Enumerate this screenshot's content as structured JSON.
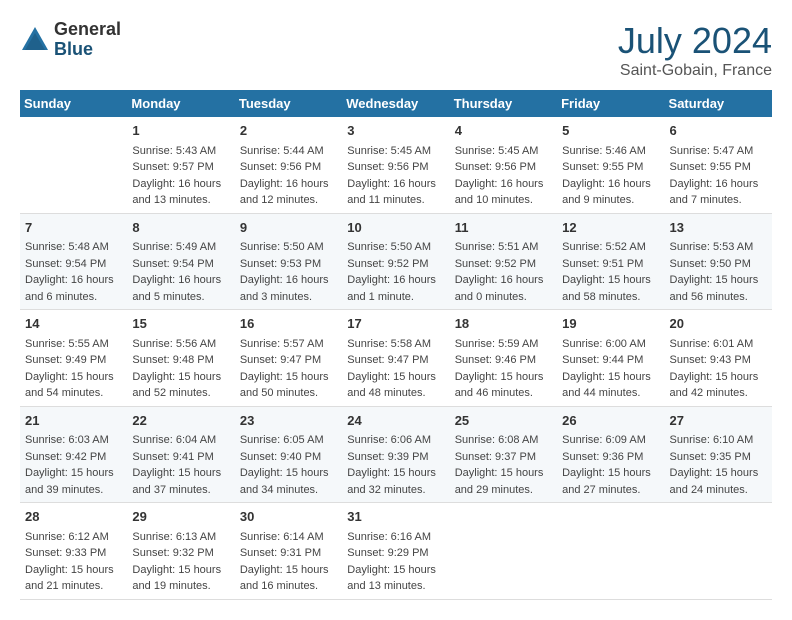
{
  "header": {
    "logo_general": "General",
    "logo_blue": "Blue",
    "month_year": "July 2024",
    "location": "Saint-Gobain, France"
  },
  "weekdays": [
    "Sunday",
    "Monday",
    "Tuesday",
    "Wednesday",
    "Thursday",
    "Friday",
    "Saturday"
  ],
  "weeks": [
    [
      {
        "day": "",
        "sunrise": "",
        "sunset": "",
        "daylight": ""
      },
      {
        "day": "1",
        "sunrise": "Sunrise: 5:43 AM",
        "sunset": "Sunset: 9:57 PM",
        "daylight": "Daylight: 16 hours and 13 minutes."
      },
      {
        "day": "2",
        "sunrise": "Sunrise: 5:44 AM",
        "sunset": "Sunset: 9:56 PM",
        "daylight": "Daylight: 16 hours and 12 minutes."
      },
      {
        "day": "3",
        "sunrise": "Sunrise: 5:45 AM",
        "sunset": "Sunset: 9:56 PM",
        "daylight": "Daylight: 16 hours and 11 minutes."
      },
      {
        "day": "4",
        "sunrise": "Sunrise: 5:45 AM",
        "sunset": "Sunset: 9:56 PM",
        "daylight": "Daylight: 16 hours and 10 minutes."
      },
      {
        "day": "5",
        "sunrise": "Sunrise: 5:46 AM",
        "sunset": "Sunset: 9:55 PM",
        "daylight": "Daylight: 16 hours and 9 minutes."
      },
      {
        "day": "6",
        "sunrise": "Sunrise: 5:47 AM",
        "sunset": "Sunset: 9:55 PM",
        "daylight": "Daylight: 16 hours and 7 minutes."
      }
    ],
    [
      {
        "day": "7",
        "sunrise": "Sunrise: 5:48 AM",
        "sunset": "Sunset: 9:54 PM",
        "daylight": "Daylight: 16 hours and 6 minutes."
      },
      {
        "day": "8",
        "sunrise": "Sunrise: 5:49 AM",
        "sunset": "Sunset: 9:54 PM",
        "daylight": "Daylight: 16 hours and 5 minutes."
      },
      {
        "day": "9",
        "sunrise": "Sunrise: 5:50 AM",
        "sunset": "Sunset: 9:53 PM",
        "daylight": "Daylight: 16 hours and 3 minutes."
      },
      {
        "day": "10",
        "sunrise": "Sunrise: 5:50 AM",
        "sunset": "Sunset: 9:52 PM",
        "daylight": "Daylight: 16 hours and 1 minute."
      },
      {
        "day": "11",
        "sunrise": "Sunrise: 5:51 AM",
        "sunset": "Sunset: 9:52 PM",
        "daylight": "Daylight: 16 hours and 0 minutes."
      },
      {
        "day": "12",
        "sunrise": "Sunrise: 5:52 AM",
        "sunset": "Sunset: 9:51 PM",
        "daylight": "Daylight: 15 hours and 58 minutes."
      },
      {
        "day": "13",
        "sunrise": "Sunrise: 5:53 AM",
        "sunset": "Sunset: 9:50 PM",
        "daylight": "Daylight: 15 hours and 56 minutes."
      }
    ],
    [
      {
        "day": "14",
        "sunrise": "Sunrise: 5:55 AM",
        "sunset": "Sunset: 9:49 PM",
        "daylight": "Daylight: 15 hours and 54 minutes."
      },
      {
        "day": "15",
        "sunrise": "Sunrise: 5:56 AM",
        "sunset": "Sunset: 9:48 PM",
        "daylight": "Daylight: 15 hours and 52 minutes."
      },
      {
        "day": "16",
        "sunrise": "Sunrise: 5:57 AM",
        "sunset": "Sunset: 9:47 PM",
        "daylight": "Daylight: 15 hours and 50 minutes."
      },
      {
        "day": "17",
        "sunrise": "Sunrise: 5:58 AM",
        "sunset": "Sunset: 9:47 PM",
        "daylight": "Daylight: 15 hours and 48 minutes."
      },
      {
        "day": "18",
        "sunrise": "Sunrise: 5:59 AM",
        "sunset": "Sunset: 9:46 PM",
        "daylight": "Daylight: 15 hours and 46 minutes."
      },
      {
        "day": "19",
        "sunrise": "Sunrise: 6:00 AM",
        "sunset": "Sunset: 9:44 PM",
        "daylight": "Daylight: 15 hours and 44 minutes."
      },
      {
        "day": "20",
        "sunrise": "Sunrise: 6:01 AM",
        "sunset": "Sunset: 9:43 PM",
        "daylight": "Daylight: 15 hours and 42 minutes."
      }
    ],
    [
      {
        "day": "21",
        "sunrise": "Sunrise: 6:03 AM",
        "sunset": "Sunset: 9:42 PM",
        "daylight": "Daylight: 15 hours and 39 minutes."
      },
      {
        "day": "22",
        "sunrise": "Sunrise: 6:04 AM",
        "sunset": "Sunset: 9:41 PM",
        "daylight": "Daylight: 15 hours and 37 minutes."
      },
      {
        "day": "23",
        "sunrise": "Sunrise: 6:05 AM",
        "sunset": "Sunset: 9:40 PM",
        "daylight": "Daylight: 15 hours and 34 minutes."
      },
      {
        "day": "24",
        "sunrise": "Sunrise: 6:06 AM",
        "sunset": "Sunset: 9:39 PM",
        "daylight": "Daylight: 15 hours and 32 minutes."
      },
      {
        "day": "25",
        "sunrise": "Sunrise: 6:08 AM",
        "sunset": "Sunset: 9:37 PM",
        "daylight": "Daylight: 15 hours and 29 minutes."
      },
      {
        "day": "26",
        "sunrise": "Sunrise: 6:09 AM",
        "sunset": "Sunset: 9:36 PM",
        "daylight": "Daylight: 15 hours and 27 minutes."
      },
      {
        "day": "27",
        "sunrise": "Sunrise: 6:10 AM",
        "sunset": "Sunset: 9:35 PM",
        "daylight": "Daylight: 15 hours and 24 minutes."
      }
    ],
    [
      {
        "day": "28",
        "sunrise": "Sunrise: 6:12 AM",
        "sunset": "Sunset: 9:33 PM",
        "daylight": "Daylight: 15 hours and 21 minutes."
      },
      {
        "day": "29",
        "sunrise": "Sunrise: 6:13 AM",
        "sunset": "Sunset: 9:32 PM",
        "daylight": "Daylight: 15 hours and 19 minutes."
      },
      {
        "day": "30",
        "sunrise": "Sunrise: 6:14 AM",
        "sunset": "Sunset: 9:31 PM",
        "daylight": "Daylight: 15 hours and 16 minutes."
      },
      {
        "day": "31",
        "sunrise": "Sunrise: 6:16 AM",
        "sunset": "Sunset: 9:29 PM",
        "daylight": "Daylight: 15 hours and 13 minutes."
      },
      {
        "day": "",
        "sunrise": "",
        "sunset": "",
        "daylight": ""
      },
      {
        "day": "",
        "sunrise": "",
        "sunset": "",
        "daylight": ""
      },
      {
        "day": "",
        "sunrise": "",
        "sunset": "",
        "daylight": ""
      }
    ]
  ]
}
